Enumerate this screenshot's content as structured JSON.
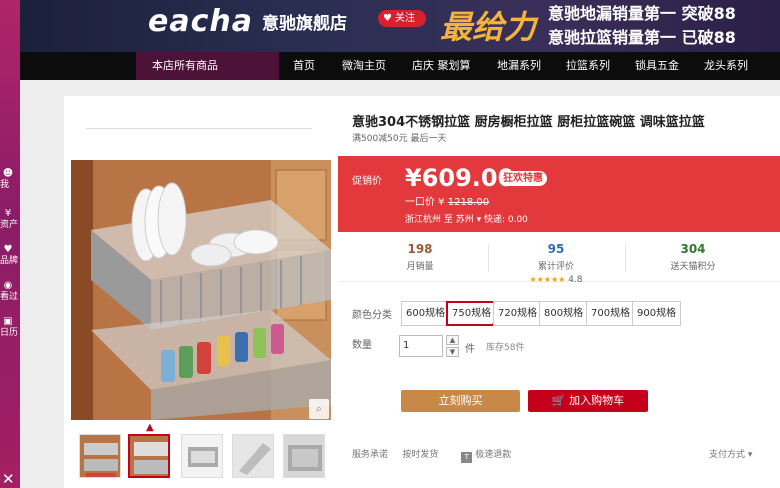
{
  "header": {
    "logo": "eacha",
    "store_name": "意驰旗舰店",
    "follow_label": "关注",
    "slogan_big": "最给力",
    "slogan_line1": "意驰地漏销量第一  突破88",
    "slogan_line2": "意驰拉篮销量第一  已破88"
  },
  "nav": {
    "all_products": "本店所有商品",
    "items": [
      "首页",
      "微淘主页",
      "店庆 聚划算",
      "地漏系列",
      "拉篮系列",
      "锁具五金",
      "龙头系列"
    ]
  },
  "rail": {
    "items": [
      "我",
      "资产",
      "品牌",
      "看过",
      "日历"
    ]
  },
  "product": {
    "title": "意驰304不锈钢拉篮 厨房橱柜拉篮 厨柜拉篮碗篮 调味篮拉篮",
    "subtitle": "满500减50元 最后一天",
    "price_label": "促销价",
    "price": "¥609.00",
    "price_tag": "狂欢特惠",
    "orig_label": "一口价 ¥",
    "orig_price": "1218.00",
    "ship_text": "浙江杭州  至  苏州 ▾  快递: 0.00"
  },
  "stats": {
    "monthly_sales": "198",
    "monthly_sales_label": "月销量",
    "reviews": "95",
    "reviews_label": "累计评价",
    "rating": "4.8",
    "points": "304",
    "points_label": "送天猫积分"
  },
  "options": {
    "label": "颜色分类",
    "items": [
      "600规格",
      "750规格",
      "720规格",
      "800规格",
      "700规格",
      "900规格"
    ],
    "selected": "750规格"
  },
  "quantity": {
    "label": "数量",
    "value": "1",
    "unit": "件",
    "stock": "库存58件"
  },
  "actions": {
    "buy_now": "立刻购买",
    "add_cart": "加入购物车"
  },
  "service": {
    "label": "服务承诺",
    "item1": "按时发货",
    "item2": "极速退款",
    "tm_badge": "T",
    "payment": "支付方式 ▾"
  },
  "colors": {
    "accent": "#c4001a",
    "price_bg": "#e4393c",
    "buy_now": "#c88948"
  }
}
